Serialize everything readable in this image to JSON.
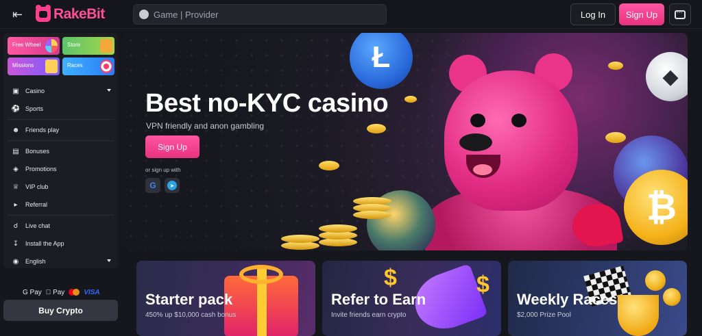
{
  "header": {
    "logo_text": "RakeBit",
    "search_placeholder": "Game | Provider",
    "login_label": "Log In",
    "signup_label": "Sign Up"
  },
  "sidebar": {
    "tiles": [
      {
        "label": "Free Wheel"
      },
      {
        "label": "Store"
      },
      {
        "label": "Missions"
      },
      {
        "label": "Races"
      }
    ],
    "items": [
      {
        "label": "Casino",
        "icon": "cube-icon"
      },
      {
        "label": "Sports",
        "icon": "ball-icon"
      },
      {
        "label": "Friends play",
        "icon": "users-icon"
      },
      {
        "label": "Bonuses",
        "icon": "gift-icon"
      },
      {
        "label": "Promotions",
        "icon": "tag-icon"
      },
      {
        "label": "VIP club",
        "icon": "crown-icon"
      },
      {
        "label": "Referral",
        "icon": "megaphone-icon"
      },
      {
        "label": "Live chat",
        "icon": "headset-icon"
      },
      {
        "label": "Install the App",
        "icon": "download-icon"
      },
      {
        "label": "English",
        "icon": "globe-icon"
      }
    ]
  },
  "payments": {
    "gpay": "G Pay",
    "applepay": " Pay",
    "visa": "VISA"
  },
  "buy_crypto_label": "Buy Crypto",
  "hero": {
    "title": "Best no-KYC casino",
    "subtitle": "VPN friendly and anon gambling",
    "signup_label": "Sign Up",
    "or_text": "or sign up with",
    "google_glyph": "G"
  },
  "cards": [
    {
      "title": "Starter pack",
      "subtitle": "450% up $10,000 cash bonus"
    },
    {
      "title": "Refer to Earn",
      "subtitle": "Invite friends earn crypto"
    },
    {
      "title": "Weekly Races",
      "subtitle": "$2,000 Prize Pool"
    }
  ],
  "colors": {
    "accent": "#ff4f99",
    "background": "#15171c",
    "sidebar": "#1b1d23"
  }
}
